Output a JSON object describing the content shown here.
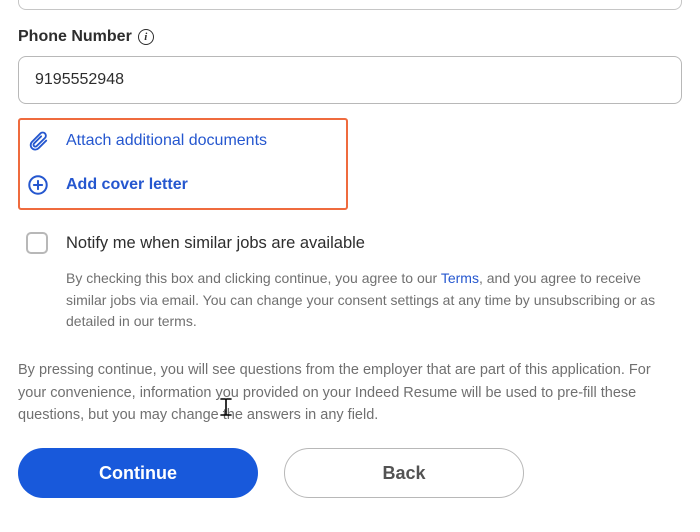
{
  "phone": {
    "label": "Phone Number",
    "value": "9195552948"
  },
  "attachments": {
    "attach_docs": "Attach additional documents",
    "add_cover": "Add cover letter"
  },
  "notify": {
    "label": "Notify me when similar jobs are available",
    "consent_pre": "By checking this box and clicking continue, you agree to our ",
    "terms_link": "Terms",
    "consent_post": ", and you agree to receive similar jobs via email. You can change your consent settings at any time by unsubscribing or as detailed in our terms."
  },
  "footer_note": "By pressing continue, you will see questions from the employer that are part of this application. For your convenience, information you provided on your Indeed Resume will be used to pre-fill these questions, but you may change the answers in any field.",
  "buttons": {
    "continue": "Continue",
    "back": "Back"
  }
}
